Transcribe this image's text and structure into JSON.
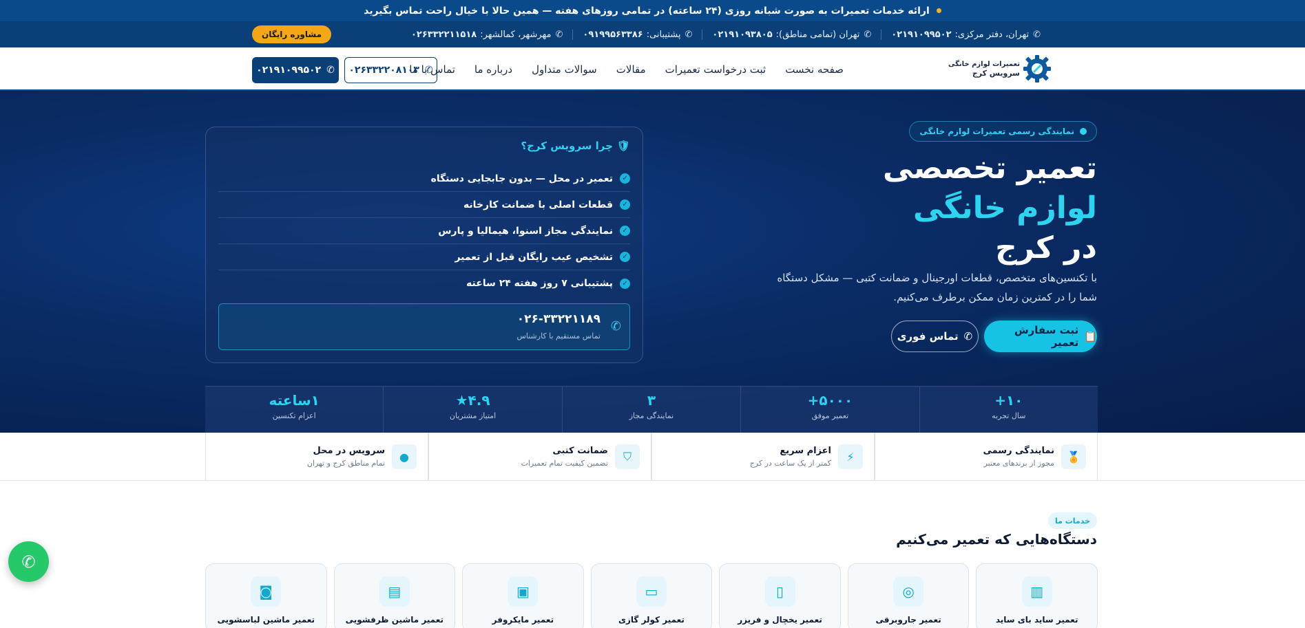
{
  "announcement": {
    "text": "ارائه خدمات تعمیرات به صورت شبانه روزی (۲۴ ساعته) در تمامی روزهای هفته — همین حالا با خیال راحت تماس بگیرید"
  },
  "contact_bar": {
    "items": [
      {
        "label": "تهران، دفتر مرکزی:",
        "number": "۰۲۱۹۱۰۹۹۵۰۲"
      },
      {
        "label": "تهران (تمامی مناطق):",
        "number": "۰۲۱۹۱۰۹۳۸۰۵"
      },
      {
        "label": "پشتیبانی:",
        "number": "۰۹۱۹۹۵۶۳۳۸۶"
      },
      {
        "label": "مهرشهر، کمالشهر:",
        "number": "۰۲۶۳۳۲۲۱۱۵۱۸"
      }
    ],
    "consult_button": "مشاوره رایگان"
  },
  "nav": {
    "logo_line1": "تعمیرات لوازم خانگی",
    "logo_line2": "سرویس کرج",
    "menu": [
      "صفحه نخست",
      "ثبت درخواست تعمیرات",
      "مقالات",
      "سوالات متداول",
      "درباره ما",
      "تماس با ما"
    ],
    "phone_outline": "۰۲۶۳۳۲۲۰۸۱۰۳",
    "phone_solid": "۰۲۱۹۱۰۹۹۵۰۲"
  },
  "hero": {
    "badge": "نمایندگی رسمی تعمیرات لوازم خانگی",
    "title_line1": "تعمیر تخصصی",
    "title_line2": "لوازم خانگی",
    "title_line3": "در کرج",
    "description": "با تکنسین‌های متخصص، قطعات اورجینال و ضمانت کتبی — مشکل دستگاه شما را در کمترین زمان ممکن برطرف می‌کنیم.",
    "btn_order": "ثبت سفارش تعمیر",
    "btn_call": "تماس فوری"
  },
  "why": {
    "title": "چرا سرویس کرج؟",
    "items": [
      "تعمیر در محل — بدون جابجایی دستگاه",
      "قطعات اصلی با ضمانت کارخانه",
      "نمایندگی مجاز اسنوا، هیمالیا و پارس",
      "تشخیص عیب رایگان قبل از تعمیر",
      "پشتیبانی ۷ روز هفته ۲۴ ساعته"
    ],
    "call_number": "۰۲۶-۳۳۲۲۱۱۸۹",
    "call_sub": "تماس مستقیم با کارشناس"
  },
  "stats": [
    {
      "value": "۱۰+",
      "label": "سال تجربه"
    },
    {
      "value": "۵۰۰۰+",
      "label": "تعمیر موفق"
    },
    {
      "value": "۳",
      "label": "نمایندگی مجاز"
    },
    {
      "value": "۴.۹★",
      "label": "امتیاز مشتریان"
    },
    {
      "value": "۱ساعته",
      "label": "اعزام تکنسین"
    }
  ],
  "features": [
    {
      "title": "نمایندگی رسمی",
      "sub": "مجوز از برندهای معتبر",
      "icon": "award-icon"
    },
    {
      "title": "اعزام سریع",
      "sub": "کمتر از یک ساعت در کرج",
      "icon": "bolt-icon"
    },
    {
      "title": "ضمانت کتبی",
      "sub": "تضمین کیفیت تمام تعمیرات",
      "icon": "shield-icon"
    },
    {
      "title": "سرویس در محل",
      "sub": "تمام مناطق کرج و تهران",
      "icon": "location-icon"
    }
  ],
  "services": {
    "tag": "خدمات ما",
    "title": "دستگاه‌هایی که تعمیر می‌کنیم",
    "items": [
      {
        "name": "تعمیر ساید بای ساید",
        "icon": "side-by-side-fridge-icon"
      },
      {
        "name": "تعمیر جاروبرقی",
        "icon": "vacuum-icon"
      },
      {
        "name": "تعمیر یخچال و فریزر",
        "icon": "fridge-icon"
      },
      {
        "name": "تعمیر کولر گازی",
        "icon": "air-conditioner-icon"
      },
      {
        "name": "تعمیر مایکروفر",
        "icon": "microwave-icon"
      },
      {
        "name": "تعمیر ماشین ظرفشویی",
        "icon": "dishwasher-icon"
      },
      {
        "name": "تعمیر ماشین لباسشویی",
        "icon": "washing-machine-icon"
      }
    ]
  },
  "colors": {
    "primary": "#0b3f78",
    "accent": "#16c3e4",
    "orange": "#f5a716",
    "green": "#26c96a"
  }
}
